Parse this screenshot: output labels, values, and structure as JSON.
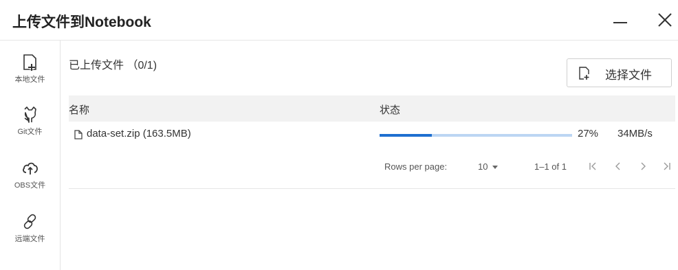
{
  "dialog": {
    "title": "上传文件到Notebook"
  },
  "window_controls": {
    "minimize_icon": "minimize-icon",
    "close_icon": "close-icon"
  },
  "sidebar": {
    "items": [
      {
        "label": "本地文件",
        "icon": "local-file-upload-icon"
      },
      {
        "label": "Git文件",
        "icon": "github-icon"
      },
      {
        "label": "OBS文件",
        "icon": "cloud-upload-icon"
      },
      {
        "label": "远端文件",
        "icon": "link-icon"
      }
    ]
  },
  "main": {
    "uploaded_title": "已上传文件 （0/1)",
    "select_button": {
      "label": "选择文件",
      "icon": "file-add-icon"
    }
  },
  "table": {
    "headers": {
      "name": "名称",
      "status": "状态"
    },
    "rows": [
      {
        "name": "data-set.zip (163.5MB)",
        "progress": 0.27,
        "percent_text": "27%",
        "speed": "34MB/s"
      }
    ]
  },
  "pagination": {
    "rows_per_page_label": "Rows per page:",
    "rows_per_page_value": "10",
    "range": "1–1 of 1"
  },
  "colors": {
    "progress_fill": "#1e6fd0",
    "progress_track": "#bcd6f3",
    "header_bg": "#f2f2f2"
  }
}
